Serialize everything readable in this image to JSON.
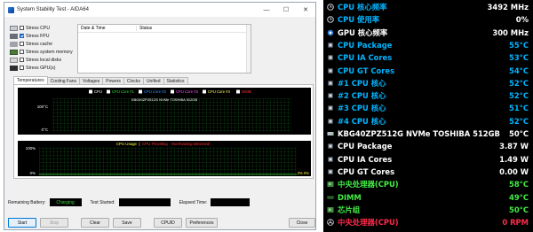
{
  "window": {
    "title": "System Stability Test - AIDA64",
    "minimize": "—",
    "maximize": "☐",
    "close": "✕"
  },
  "stress_options": [
    {
      "label": "Stress CPU",
      "checked": false,
      "icon": "cpu-icon"
    },
    {
      "label": "Stress FPU",
      "checked": true,
      "icon": "fpu-icon"
    },
    {
      "label": "Stress cache",
      "checked": false,
      "icon": "cache-icon"
    },
    {
      "label": "Stress system memory",
      "checked": false,
      "icon": "memory-icon"
    },
    {
      "label": "Stress local disks",
      "checked": false,
      "icon": "disk-icon"
    },
    {
      "label": "Stress GPU(s)",
      "checked": false,
      "icon": "gpu-icon"
    }
  ],
  "log": {
    "col_datetime": "Date & Time",
    "col_status": "Status"
  },
  "tabs": [
    "Temperatures",
    "Cooling Fans",
    "Voltages",
    "Powers",
    "Clocks",
    "Unified",
    "Statistics"
  ],
  "temp_graph": {
    "legend": [
      {
        "label": "CPU",
        "color": "#ffffff"
      },
      {
        "label": "CPU Core #1",
        "color": "#33dd33"
      },
      {
        "label": "CPU Core #2",
        "color": "#3399ff"
      },
      {
        "label": "CPU Core #3",
        "color": "#ff55ff"
      },
      {
        "label": "CPU Core #4",
        "color": "#ffff66"
      },
      {
        "label": "DIMM",
        "color": "#ff3333"
      }
    ],
    "legend2": "KBG40ZPZ512G NVMe TOSHIBA 512GB",
    "y_top": "100°C",
    "y_bottom": "0°C"
  },
  "usage_graph": {
    "legend_a": "CPU Usage",
    "legend_sep": "|",
    "legend_b": "CPU Throttling - Overheating Detected!",
    "y_top": "100%",
    "y_bottom": "0%",
    "right_val": "2% 0%"
  },
  "status": {
    "battery_label": "Remaining Battery:",
    "battery_value": "Charging",
    "test_started_label": "Test Started:",
    "elapsed_label": "Elapsed Time:"
  },
  "buttons": {
    "start": "Start",
    "stop": "Stop",
    "clear": "Clear",
    "save": "Save",
    "cpuid": "CPUID",
    "preferences": "Preferences",
    "close": "Close"
  },
  "sensors": [
    {
      "icon": "clock-icon",
      "label": "CPU 核心频率",
      "value": "3492 MHz",
      "label_color": "#00b4ff",
      "value_color": "#ffffff"
    },
    {
      "icon": "clock-icon",
      "label": "CPU 使用率",
      "value": "0%",
      "label_color": "#00b4ff",
      "value_color": "#ffffff"
    },
    {
      "icon": "gpu-chip-icon",
      "label": "GPU 核心频率",
      "value": "300 MHz",
      "label_color": "#ffffff",
      "value_color": "#ffffff"
    },
    {
      "icon": "chip-icon",
      "label": "CPU Package",
      "value": "55°C",
      "label_color": "#00b4ff",
      "value_color": "#00b4ff"
    },
    {
      "icon": "chip-icon",
      "label": "CPU IA Cores",
      "value": "53°C",
      "label_color": "#00b4ff",
      "value_color": "#00b4ff"
    },
    {
      "icon": "chip-icon",
      "label": "CPU GT Cores",
      "value": "54°C",
      "label_color": "#00b4ff",
      "value_color": "#00b4ff"
    },
    {
      "icon": "chip-icon",
      "label": "#1 CPU 核心",
      "value": "52°C",
      "label_color": "#00b4ff",
      "value_color": "#00b4ff"
    },
    {
      "icon": "chip-icon",
      "label": "#2 CPU 核心",
      "value": "52°C",
      "label_color": "#00b4ff",
      "value_color": "#00b4ff"
    },
    {
      "icon": "chip-icon",
      "label": "#3 CPU 核心",
      "value": "51°C",
      "label_color": "#00b4ff",
      "value_color": "#00b4ff"
    },
    {
      "icon": "chip-icon",
      "label": "#4 CPU 核心",
      "value": "52°C",
      "label_color": "#00b4ff",
      "value_color": "#00b4ff"
    },
    {
      "icon": "disk-icon",
      "label": "KBG40ZPZ512G NVMe TOSHIBA 512GB",
      "value": "50°C",
      "label_color": "#ffffff",
      "value_color": "#ffffff"
    },
    {
      "icon": "chip-icon",
      "label": "CPU Package",
      "value": "3.87 W",
      "label_color": "#ffffff",
      "value_color": "#ffffff"
    },
    {
      "icon": "chip-icon",
      "label": "CPU IA Cores",
      "value": "1.49 W",
      "label_color": "#ffffff",
      "value_color": "#ffffff"
    },
    {
      "icon": "chip-icon",
      "label": "CPU GT Cores",
      "value": "0.00 W",
      "label_color": "#ffffff",
      "value_color": "#ffffff"
    },
    {
      "icon": "board-icon",
      "label": "中央处理器(CPU)",
      "value": "58°C",
      "label_color": "#44ee44",
      "value_color": "#44ee44"
    },
    {
      "icon": "memory-icon",
      "label": "DIMM",
      "value": "49°C",
      "label_color": "#44ee44",
      "value_color": "#44ee44"
    },
    {
      "icon": "board-icon",
      "label": "芯片组",
      "value": "50°C",
      "label_color": "#44ee44",
      "value_color": "#44ee44"
    },
    {
      "icon": "fan-icon",
      "label": "中央处理器(CPU)",
      "value": "0 RPM",
      "label_color": "#ff2a4a",
      "value_color": "#ff2a4a"
    }
  ]
}
